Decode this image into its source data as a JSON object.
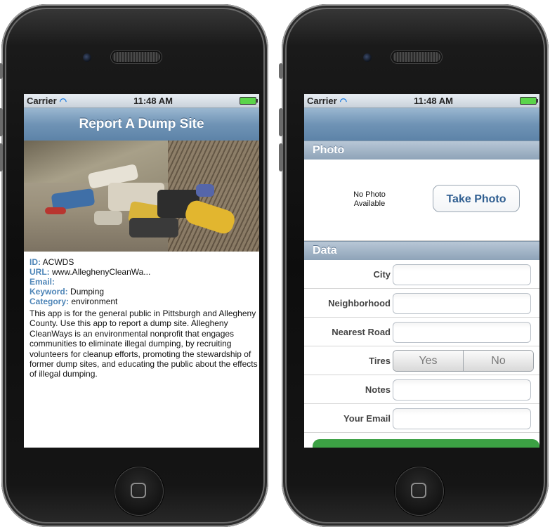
{
  "left_screen": {
    "status": {
      "carrier": "Carrier",
      "time": "11:48 AM"
    },
    "title": "Report A Dump Site",
    "info": {
      "id_label": "ID:",
      "id_value": "ACWDS",
      "url_label": "URL:",
      "url_value": "www.AlleghenyCleanWa...",
      "email_label": "Email:",
      "email_value": "",
      "keyword_label": "Keyword:",
      "keyword_value": "Dumping",
      "category_label": "Category:",
      "category_value": "environment"
    },
    "description": "This app is for the general public in Pittsburgh and Allegheny County. Use this app to report a dump site. Allegheny CleanWays is an environmental nonprofit that engages communities to eliminate illegal dumping, by recruiting volunteers for cleanup efforts, promoting the stewardship of former dump sites, and educating the public about the effects of illegal dumping."
  },
  "right_screen": {
    "status": {
      "carrier": "Carrier",
      "time": "11:48 AM"
    },
    "photo_section": "Photo",
    "no_photo": "No Photo Available",
    "take_photo": "Take Photo",
    "data_section": "Data",
    "fields": {
      "city": "City",
      "neighborhood": "Neighborhood",
      "nearest_road": "Nearest Road",
      "tires": "Tires",
      "notes": "Notes",
      "your_email": "Your Email"
    },
    "tires_options": {
      "yes": "Yes",
      "no": "No"
    }
  },
  "colors": {
    "nav": "#6f93b5",
    "label_blue": "#4f86b8",
    "button_text": "#305f91",
    "green": "#3ca144"
  }
}
